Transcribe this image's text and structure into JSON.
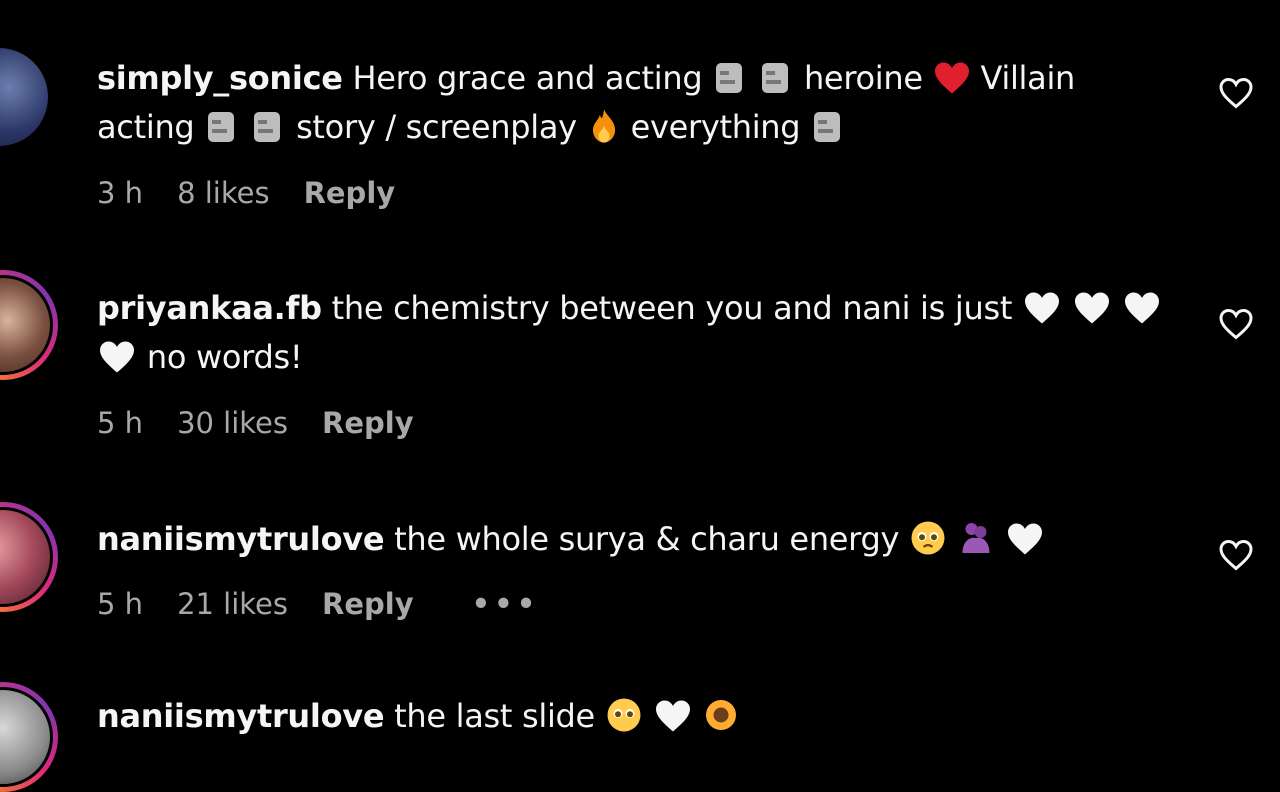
{
  "comments": [
    {
      "username": "simply_sonice",
      "text_parts": [
        "Hero grace and acting",
        "heroine",
        "Villain acting",
        "story / screenplay",
        "everything"
      ],
      "time": "3 h",
      "likes": "8 likes",
      "reply": "Reply"
    },
    {
      "username": "priyankaa.fb",
      "text_parts": [
        "the chemistry between you and nani is just",
        "no words!"
      ],
      "time": "5 h",
      "likes": "30 likes",
      "reply": "Reply"
    },
    {
      "username": "naniismytrulove",
      "text_parts": [
        "the whole surya & charu energy"
      ],
      "time": "5 h",
      "likes": "21 likes",
      "reply": "Reply",
      "more": "•••"
    },
    {
      "username": "naniismytrulove",
      "text_parts": [
        "the last slide"
      ]
    }
  ],
  "icons": {
    "like": "heart-outline-icon",
    "more": "more-options-icon"
  },
  "colors": {
    "background": "#000000",
    "text": "#f5f5f5",
    "meta": "#a8a8a8",
    "story_ring": "#dd2a7b"
  }
}
